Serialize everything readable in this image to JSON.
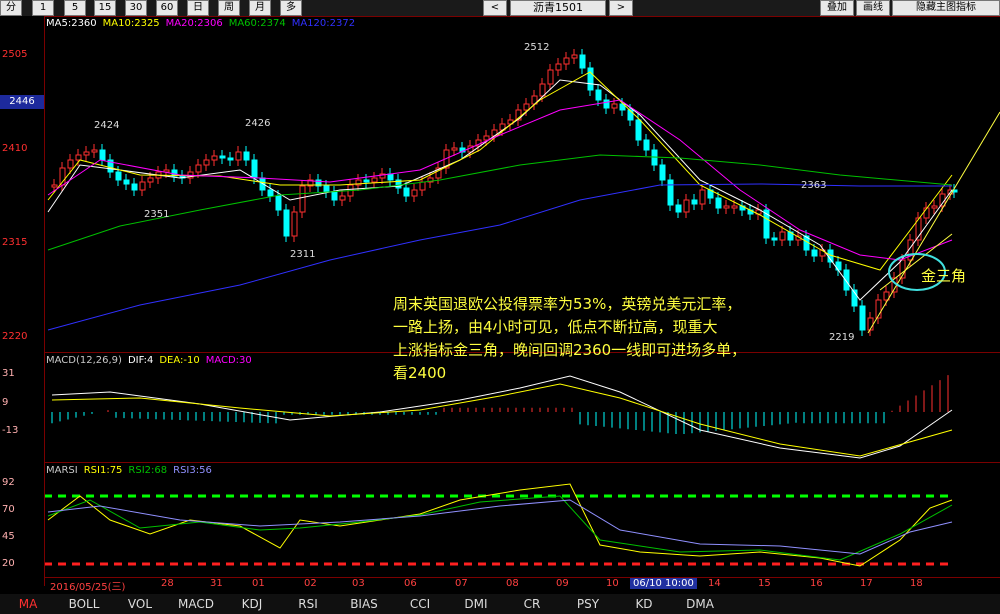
{
  "toolbar": {
    "periods": [
      "分",
      "1",
      "5",
      "15",
      "30",
      "60",
      "日",
      "周",
      "月",
      "多"
    ],
    "nav_prev": "<",
    "symbol": "沥青1501",
    "nav_next": ">",
    "right_buttons": [
      "叠加",
      "画线",
      "隐藏主图指标"
    ]
  },
  "main_chart": {
    "y_labels": [
      "2505",
      "2410",
      "2315",
      "2220"
    ],
    "current_price": "2446",
    "legend": [
      {
        "text": "MA5:2360",
        "color": "#ffffff"
      },
      {
        "text": "MA10:2325",
        "color": "#ffff00"
      },
      {
        "text": "MA20:2306",
        "color": "#ff00ff"
      },
      {
        "text": "MA60:2374",
        "color": "#00c000"
      },
      {
        "text": "MA120:2372",
        "color": "#3030ff"
      }
    ],
    "annotations": [
      "2512",
      "2424",
      "2426",
      "2351",
      "2311",
      "2363",
      "2219"
    ],
    "comment_lines": [
      "周末英国退欧公投得票率为53%，英镑兑美元汇率，",
      "一路上扬，由4小时可见，低点不断拉高，现重大",
      "上涨指标金三角，晚间回调2360一线即可进场多单，",
      "看2400"
    ],
    "gold_label": "金三角"
  },
  "macd_panel": {
    "y_labels": [
      "31",
      "9",
      "-13"
    ],
    "legend": [
      {
        "text": "MACD(12,26,9)",
        "color": "#c8c8c8"
      },
      {
        "text": "DIF:4",
        "color": "#ffffff"
      },
      {
        "text": "DEA:-10",
        "color": "#ffff00"
      },
      {
        "text": "MACD:30",
        "color": "#ff00ff"
      }
    ]
  },
  "rsi_panel": {
    "y_labels": [
      "92",
      "70",
      "45",
      "20"
    ],
    "legend": [
      {
        "text": "MARSI",
        "color": "#c8c8c8"
      },
      {
        "text": "RSI1:75",
        "color": "#ffff00"
      },
      {
        "text": "RSI2:68",
        "color": "#00c000"
      },
      {
        "text": "RSI3:56",
        "color": "#9090ff"
      }
    ]
  },
  "dates": [
    "2016/05/25(三)",
    "28",
    "31",
    "01",
    "02",
    "03",
    "06",
    "07",
    "08",
    "09",
    "10",
    "06/10 10:00",
    "14",
    "15",
    "16",
    "17",
    "18"
  ],
  "bottom_tabs": [
    "MA",
    "BOLL",
    "VOL",
    "MACD",
    "KDJ",
    "RSI",
    "BIAS",
    "CCI",
    "DMI",
    "CR",
    "PSY",
    "KD",
    "DMA"
  ],
  "active_tab": "MA",
  "colors": {
    "up": "#ff3030",
    "down": "#00ffff",
    "accent": "#ffff40"
  }
}
